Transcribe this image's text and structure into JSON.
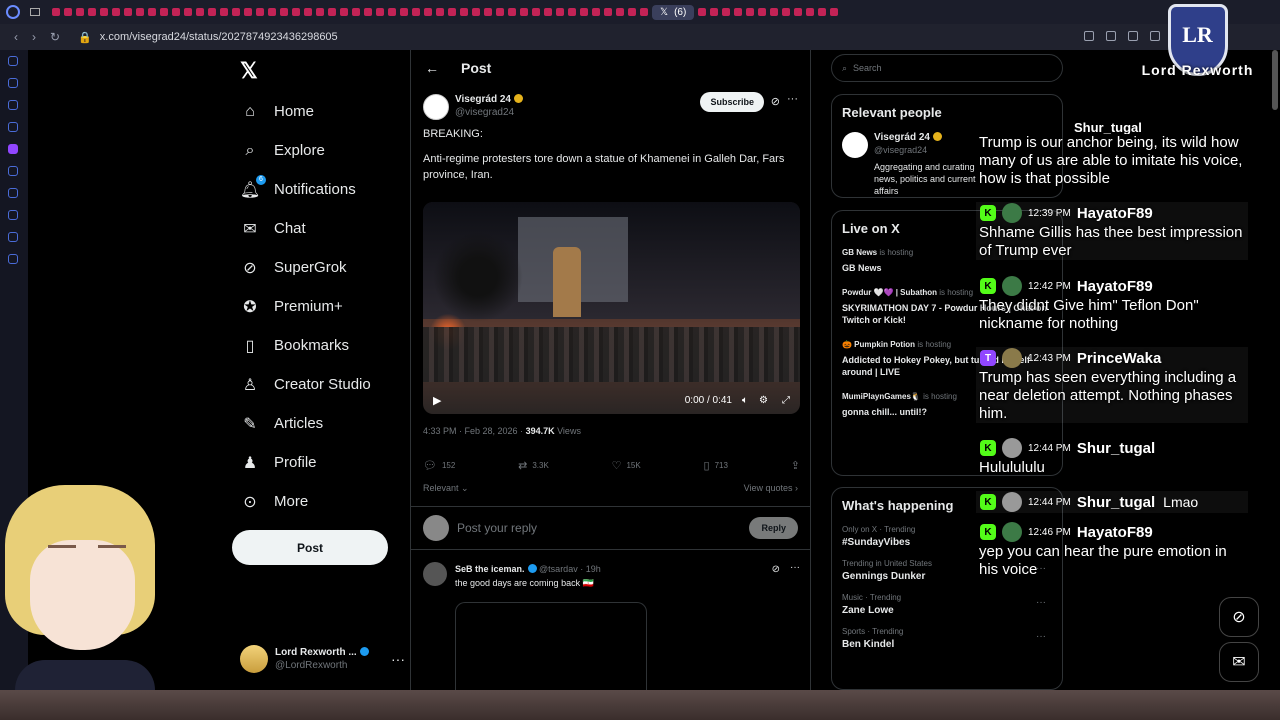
{
  "browser": {
    "active_tab_count": "(6)",
    "url": "x.com/visegrad24/status/2027874923436298605"
  },
  "nav": {
    "items": [
      {
        "label": "Home",
        "icon": "home-icon"
      },
      {
        "label": "Explore",
        "icon": "search-icon"
      },
      {
        "label": "Notifications",
        "icon": "bell-icon",
        "badge": "6"
      },
      {
        "label": "Chat",
        "icon": "mail-icon"
      },
      {
        "label": "SuperGrok",
        "icon": "grok-icon"
      },
      {
        "label": "Premium+",
        "icon": "verified-icon"
      },
      {
        "label": "Bookmarks",
        "icon": "bookmark-icon"
      },
      {
        "label": "Creator Studio",
        "icon": "creator-icon"
      },
      {
        "label": "Articles",
        "icon": "articles-icon"
      },
      {
        "label": "Profile",
        "icon": "person-icon"
      },
      {
        "label": "More",
        "icon": "more-icon"
      }
    ],
    "post_label": "Post",
    "account_name": "Lord Rexworth ...",
    "account_handle": "@LordRexworth"
  },
  "post": {
    "header_title": "Post",
    "author_name": "Visegrád 24",
    "author_handle": "@visegrad24",
    "subscribe_label": "Subscribe",
    "text_1": "BREAKING:",
    "text_2": "Anti-regime protesters tore down a statue of Khamenei in Galleh Dar, Fars province, Iran.",
    "video_time": "0:00 / 0:41",
    "timestamp": "4:33 PM · Feb 28, 2026 · ",
    "views_count": "394.7K",
    "views_label": " Views",
    "replies": "152",
    "reposts": "3.3K",
    "likes": "15K",
    "bookmarks": "713",
    "sort_label": "Relevant",
    "view_quotes": "View quotes",
    "reply_placeholder": "Post your reply",
    "reply_button": "Reply"
  },
  "reply": {
    "name": "SeB the iceman.",
    "handle": "@tsardav · 19h",
    "text": "the good days are coming back 🇮🇷"
  },
  "sidebar": {
    "search_placeholder": "Search",
    "relevant_title": "Relevant people",
    "relevant_name": "Visegrád 24",
    "relevant_handle": "@visegrad24",
    "relevant_bio": "Aggregating and curating news, politics and current affairs",
    "live_title": "Live on X",
    "live": [
      {
        "host": "GB News",
        "status": "is hosting",
        "title": "GB News"
      },
      {
        "host": "Powdur 🤍💜 | Subathon",
        "status": "is hosting",
        "title": "SKYRIMATHON DAY 7 - Powdur Hours | Chat on Twitch or Kick!"
      },
      {
        "host": "🎃 Pumpkin Potion",
        "status": "is hosting",
        "title": "Addicted to Hokey Pokey, but turned myself around | LIVE"
      },
      {
        "host": "MumiPlaynGames🐧",
        "status": "is hosting",
        "title": "gonna chill... until!?"
      }
    ],
    "happening_title": "What's happening",
    "trends": [
      {
        "context": "Only on X · Trending",
        "title": "#SundayVibes"
      },
      {
        "context": "Trending in United States",
        "title": "Gennings Dunker"
      },
      {
        "context": "Music · Trending",
        "title": "Zane Lowe"
      },
      {
        "context": "Sports · Trending",
        "title": "Ben Kindel"
      }
    ]
  },
  "chat": {
    "messages": [
      {
        "platform": "",
        "time": "",
        "user": "Shur_tugal",
        "text": "Trump is our anchor being, its wild how many of us are able to imitate his voice, how is that possible"
      },
      {
        "platform": "K",
        "time": "12:39 PM",
        "user": "HayatoF89",
        "text": "Shhame Gillis has thee best impression of Trump ever"
      },
      {
        "platform": "K",
        "time": "12:42 PM",
        "user": "HayatoF89",
        "text": "They didnt Give him\" Teflon Don\" nickname for nothing"
      },
      {
        "platform": "T",
        "time": "12:43 PM",
        "user": "PrinceWaka",
        "text": "Trump has seen everything including a near deletion attempt. Nothing phases him."
      },
      {
        "platform": "K",
        "time": "12:44 PM",
        "user": "Shur_tugal",
        "text": "Hululululu"
      },
      {
        "platform": "K",
        "time": "12:44 PM",
        "user": "Shur_tugal",
        "inline": "Lmao",
        "text": ""
      },
      {
        "platform": "K",
        "time": "12:46 PM",
        "user": "HayatoF89",
        "text": "yep you can hear the pure emotion in his voice"
      }
    ]
  },
  "overlay": {
    "brand": "Lord Rexworth",
    "monogram": "LR"
  },
  "colors": {
    "accent": "#1d9bf0",
    "kick": "#53fc18",
    "twitch": "#9146ff"
  }
}
